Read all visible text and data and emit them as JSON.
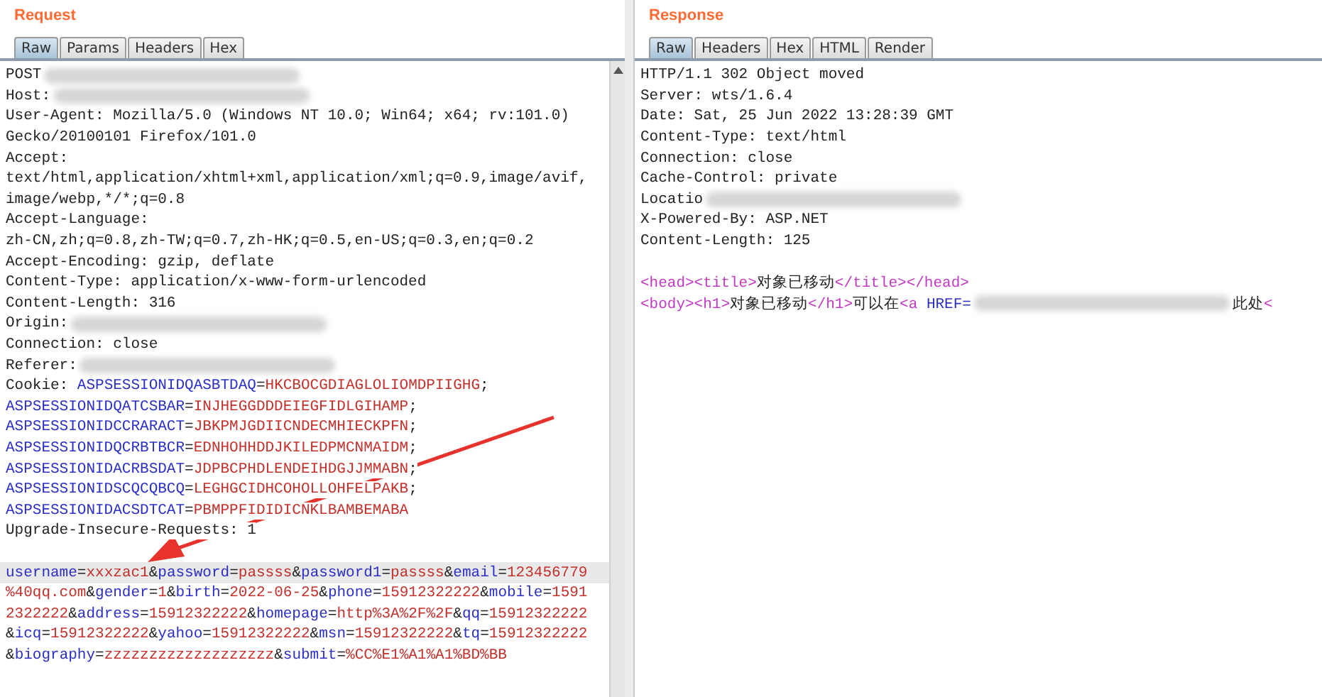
{
  "panels": [
    {
      "title": "Request",
      "tabs": [
        {
          "label": "Raw",
          "selected": true
        },
        {
          "label": "Params",
          "selected": false
        },
        {
          "label": "Headers",
          "selected": false
        },
        {
          "label": "Hex",
          "selected": false
        }
      ],
      "lines": [
        {
          "kind": "code",
          "highlighted": false,
          "segments": [
            {
              "kind": "plain",
              "text": "POST"
            },
            {
              "kind": "redacted"
            }
          ]
        },
        {
          "kind": "code",
          "highlighted": false,
          "segments": [
            {
              "kind": "plain",
              "text": "Host:"
            },
            {
              "kind": "redacted"
            }
          ]
        },
        {
          "kind": "code",
          "highlighted": false,
          "segments": [
            {
              "kind": "plain",
              "text": "User-Agent: Mozilla/5.0 (Windows NT 10.0; Win64; x64; rv:101.0)"
            }
          ]
        },
        {
          "kind": "code",
          "highlighted": false,
          "segments": [
            {
              "kind": "plain",
              "text": "Gecko/20100101 Firefox/101.0"
            }
          ]
        },
        {
          "kind": "code",
          "highlighted": false,
          "segments": [
            {
              "kind": "plain",
              "text": "Accept:"
            }
          ]
        },
        {
          "kind": "code",
          "highlighted": false,
          "segments": [
            {
              "kind": "plain",
              "text": "text/html,application/xhtml+xml,application/xml;q=0.9,image/avif,"
            }
          ]
        },
        {
          "kind": "code",
          "highlighted": false,
          "segments": [
            {
              "kind": "plain",
              "text": "image/webp,*/*;q=0.8"
            }
          ]
        },
        {
          "kind": "code",
          "highlighted": false,
          "segments": [
            {
              "kind": "plain",
              "text": "Accept-Language:"
            }
          ]
        },
        {
          "kind": "code",
          "highlighted": false,
          "segments": [
            {
              "kind": "plain",
              "text": "zh-CN,zh;q=0.8,zh-TW;q=0.7,zh-HK;q=0.5,en-US;q=0.3,en;q=0.2"
            }
          ]
        },
        {
          "kind": "code",
          "highlighted": false,
          "segments": [
            {
              "kind": "plain",
              "text": "Accept-Encoding: gzip, deflate"
            }
          ]
        },
        {
          "kind": "code",
          "highlighted": false,
          "segments": [
            {
              "kind": "plain",
              "text": "Content-Type: application/x-www-form-urlencoded"
            }
          ]
        },
        {
          "kind": "code",
          "highlighted": false,
          "segments": [
            {
              "kind": "plain",
              "text": "Content-Length: 316"
            }
          ]
        },
        {
          "kind": "code",
          "highlighted": false,
          "segments": [
            {
              "kind": "plain",
              "text": "Origin:"
            },
            {
              "kind": "redacted"
            }
          ]
        },
        {
          "kind": "code",
          "highlighted": false,
          "segments": [
            {
              "kind": "plain",
              "text": "Connection: close"
            }
          ]
        },
        {
          "kind": "code",
          "highlighted": false,
          "segments": [
            {
              "kind": "plain",
              "text": "Referer:"
            },
            {
              "kind": "redacted"
            }
          ]
        },
        {
          "kind": "code",
          "highlighted": false,
          "segments": [
            {
              "kind": "plain",
              "text": "Cookie: "
            },
            {
              "kind": "key",
              "text": "ASPSESSIONIDQASBTDAQ"
            },
            {
              "kind": "plain",
              "text": "="
            },
            {
              "kind": "value",
              "text": "HKCBOCGDIAGLOLIOMDPIIGHG"
            },
            {
              "kind": "plain",
              "text": ";"
            }
          ]
        },
        {
          "kind": "code",
          "highlighted": false,
          "segments": [
            {
              "kind": "key",
              "text": "ASPSESSIONIDQATCSBAR"
            },
            {
              "kind": "plain",
              "text": "="
            },
            {
              "kind": "value",
              "text": "INJHEGGDDDEIEGFIDLGIHAMP"
            },
            {
              "kind": "plain",
              "text": ";"
            }
          ]
        },
        {
          "kind": "code",
          "highlighted": false,
          "segments": [
            {
              "kind": "key",
              "text": "ASPSESSIONIDCCRARACT"
            },
            {
              "kind": "plain",
              "text": "="
            },
            {
              "kind": "value",
              "text": "JBKPMJGDIICNDECMHIECKPFN"
            },
            {
              "kind": "plain",
              "text": ";"
            }
          ]
        },
        {
          "kind": "code",
          "highlighted": false,
          "segments": [
            {
              "kind": "key",
              "text": "ASPSESSIONIDQCRBTBCR"
            },
            {
              "kind": "plain",
              "text": "="
            },
            {
              "kind": "value",
              "text": "EDNHOHHDDJKILEDPMCNMAIDM"
            },
            {
              "kind": "plain",
              "text": ";"
            }
          ]
        },
        {
          "kind": "code",
          "highlighted": false,
          "segments": [
            {
              "kind": "key",
              "text": "ASPSESSIONIDACRBSDAT"
            },
            {
              "kind": "plain",
              "text": "="
            },
            {
              "kind": "value",
              "text": "JDPBCPHDLENDEIHDGJJMMABN"
            },
            {
              "kind": "plain",
              "text": ";"
            }
          ]
        },
        {
          "kind": "code",
          "highlighted": false,
          "segments": [
            {
              "kind": "key",
              "text": "ASPSESSIONIDSCQCQBCQ"
            },
            {
              "kind": "plain",
              "text": "="
            },
            {
              "kind": "value",
              "text": "LEGHGCIDHCOHOLLOHFELPAKB"
            },
            {
              "kind": "plain",
              "text": ";"
            }
          ]
        },
        {
          "kind": "code",
          "highlighted": false,
          "segments": [
            {
              "kind": "key",
              "text": "ASPSESSIONIDACSDTCAT"
            },
            {
              "kind": "plain",
              "text": "="
            },
            {
              "kind": "value",
              "text": "PBMPPFIDIDICNKLBAMBEMABA"
            }
          ]
        },
        {
          "kind": "code",
          "highlighted": false,
          "segments": [
            {
              "kind": "plain",
              "text": "Upgrade-Insecure-Requests: 1"
            }
          ]
        },
        {
          "kind": "blank"
        },
        {
          "kind": "code",
          "highlighted": true,
          "segments": [
            {
              "kind": "key",
              "text": "username"
            },
            {
              "kind": "plain",
              "text": "="
            },
            {
              "kind": "value",
              "text": "xxxzac1"
            },
            {
              "kind": "plain",
              "text": "&"
            },
            {
              "kind": "key",
              "text": "password"
            },
            {
              "kind": "plain",
              "text": "="
            },
            {
              "kind": "value",
              "text": "passss"
            },
            {
              "kind": "plain",
              "text": "&"
            },
            {
              "kind": "key",
              "text": "password1"
            },
            {
              "kind": "plain",
              "text": "="
            },
            {
              "kind": "value",
              "text": "passss"
            },
            {
              "kind": "plain",
              "text": "&"
            },
            {
              "kind": "key",
              "text": "email"
            },
            {
              "kind": "plain",
              "text": "="
            },
            {
              "kind": "value",
              "text": "123456779"
            }
          ]
        },
        {
          "kind": "code",
          "highlighted": false,
          "segments": [
            {
              "kind": "value",
              "text": "%40qq.com"
            },
            {
              "kind": "plain",
              "text": "&"
            },
            {
              "kind": "key",
              "text": "gender"
            },
            {
              "kind": "plain",
              "text": "="
            },
            {
              "kind": "value",
              "text": "1"
            },
            {
              "kind": "plain",
              "text": "&"
            },
            {
              "kind": "key",
              "text": "birth"
            },
            {
              "kind": "plain",
              "text": "="
            },
            {
              "kind": "value",
              "text": "2022-06-25"
            },
            {
              "kind": "plain",
              "text": "&"
            },
            {
              "kind": "key",
              "text": "phone"
            },
            {
              "kind": "plain",
              "text": "="
            },
            {
              "kind": "value",
              "text": "15912322222"
            },
            {
              "kind": "plain",
              "text": "&"
            },
            {
              "kind": "key",
              "text": "mobile"
            },
            {
              "kind": "plain",
              "text": "="
            },
            {
              "kind": "value",
              "text": "1591"
            }
          ]
        },
        {
          "kind": "code",
          "highlighted": false,
          "segments": [
            {
              "kind": "value",
              "text": "2322222"
            },
            {
              "kind": "plain",
              "text": "&"
            },
            {
              "kind": "key",
              "text": "address"
            },
            {
              "kind": "plain",
              "text": "="
            },
            {
              "kind": "value",
              "text": "15912322222"
            },
            {
              "kind": "plain",
              "text": "&"
            },
            {
              "kind": "key",
              "text": "homepage"
            },
            {
              "kind": "plain",
              "text": "="
            },
            {
              "kind": "value",
              "text": "http%3A%2F%2F"
            },
            {
              "kind": "plain",
              "text": "&"
            },
            {
              "kind": "key",
              "text": "qq"
            },
            {
              "kind": "plain",
              "text": "="
            },
            {
              "kind": "value",
              "text": "15912322222"
            }
          ]
        },
        {
          "kind": "code",
          "highlighted": false,
          "segments": [
            {
              "kind": "plain",
              "text": "&"
            },
            {
              "kind": "key",
              "text": "icq"
            },
            {
              "kind": "plain",
              "text": "="
            },
            {
              "kind": "value",
              "text": "15912322222"
            },
            {
              "kind": "plain",
              "text": "&"
            },
            {
              "kind": "key",
              "text": "yahoo"
            },
            {
              "kind": "plain",
              "text": "="
            },
            {
              "kind": "value",
              "text": "15912322222"
            },
            {
              "kind": "plain",
              "text": "&"
            },
            {
              "kind": "key",
              "text": "msn"
            },
            {
              "kind": "plain",
              "text": "="
            },
            {
              "kind": "value",
              "text": "15912322222"
            },
            {
              "kind": "plain",
              "text": "&"
            },
            {
              "kind": "key",
              "text": "tq"
            },
            {
              "kind": "plain",
              "text": "="
            },
            {
              "kind": "value",
              "text": "15912322222"
            }
          ]
        },
        {
          "kind": "code",
          "highlighted": false,
          "segments": [
            {
              "kind": "plain",
              "text": "&"
            },
            {
              "kind": "key",
              "text": "biography"
            },
            {
              "kind": "plain",
              "text": "="
            },
            {
              "kind": "value",
              "text": "zzzzzzzzzzzzzzzzzzz"
            },
            {
              "kind": "plain",
              "text": "&"
            },
            {
              "kind": "key",
              "text": "submit"
            },
            {
              "kind": "plain",
              "text": "="
            },
            {
              "kind": "value",
              "text": "%CC%E1%A1%A1%BD%BB"
            }
          ]
        }
      ]
    },
    {
      "title": "Response",
      "tabs": [
        {
          "label": "Raw",
          "selected": true
        },
        {
          "label": "Headers",
          "selected": false
        },
        {
          "label": "Hex",
          "selected": false
        },
        {
          "label": "HTML",
          "selected": false
        },
        {
          "label": "Render",
          "selected": false
        }
      ],
      "lines": [
        {
          "kind": "code",
          "highlighted": false,
          "segments": [
            {
              "kind": "plain",
              "text": "HTTP/1.1 302 Object moved"
            }
          ]
        },
        {
          "kind": "code",
          "highlighted": false,
          "segments": [
            {
              "kind": "plain",
              "text": "Server: wts/1.6.4"
            }
          ]
        },
        {
          "kind": "code",
          "highlighted": false,
          "segments": [
            {
              "kind": "plain",
              "text": "Date: Sat, 25 Jun 2022 13:28:39 GMT"
            }
          ]
        },
        {
          "kind": "code",
          "highlighted": false,
          "segments": [
            {
              "kind": "plain",
              "text": "Content-Type: text/html"
            }
          ]
        },
        {
          "kind": "code",
          "highlighted": false,
          "segments": [
            {
              "kind": "plain",
              "text": "Connection: close"
            }
          ]
        },
        {
          "kind": "code",
          "highlighted": false,
          "segments": [
            {
              "kind": "plain",
              "text": "Cache-Control: private"
            }
          ]
        },
        {
          "kind": "code",
          "highlighted": false,
          "segments": [
            {
              "kind": "plain",
              "text": "Locatio"
            },
            {
              "kind": "redacted"
            }
          ]
        },
        {
          "kind": "code",
          "highlighted": false,
          "segments": [
            {
              "kind": "plain",
              "text": "X-Powered-By: ASP.NET"
            }
          ]
        },
        {
          "kind": "code",
          "highlighted": false,
          "segments": [
            {
              "kind": "plain",
              "text": "Content-Length: 125"
            }
          ]
        },
        {
          "kind": "blank"
        },
        {
          "kind": "code",
          "highlighted": false,
          "segments": [
            {
              "kind": "tag",
              "text": "<head><title>"
            },
            {
              "kind": "plain",
              "text": "对象已移动"
            },
            {
              "kind": "tag",
              "text": "</title></head>"
            }
          ]
        },
        {
          "kind": "code",
          "highlighted": false,
          "segments": [
            {
              "kind": "tag",
              "text": "<body><h1>"
            },
            {
              "kind": "plain",
              "text": "对象已移动"
            },
            {
              "kind": "tag",
              "text": "</h1>"
            },
            {
              "kind": "plain",
              "text": "可以在"
            },
            {
              "kind": "tag",
              "text": "<a "
            },
            {
              "kind": "key",
              "text": "HREF="
            },
            {
              "kind": "redacted"
            },
            {
              "kind": "plain",
              "text": "此处"
            },
            {
              "kind": "tag",
              "text": "<"
            }
          ]
        }
      ]
    }
  ]
}
